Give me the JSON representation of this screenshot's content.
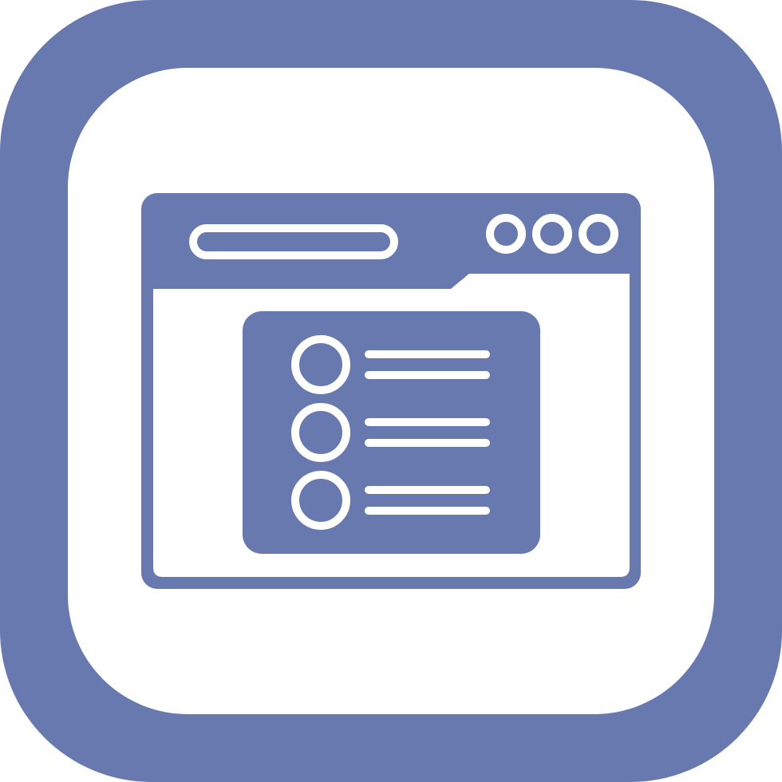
{
  "icon": {
    "name": "browser-list-icon",
    "colors": {
      "primary": "#6879B0",
      "background": "#FFFFFF"
    },
    "list_items": 3,
    "window_dots": 3
  }
}
